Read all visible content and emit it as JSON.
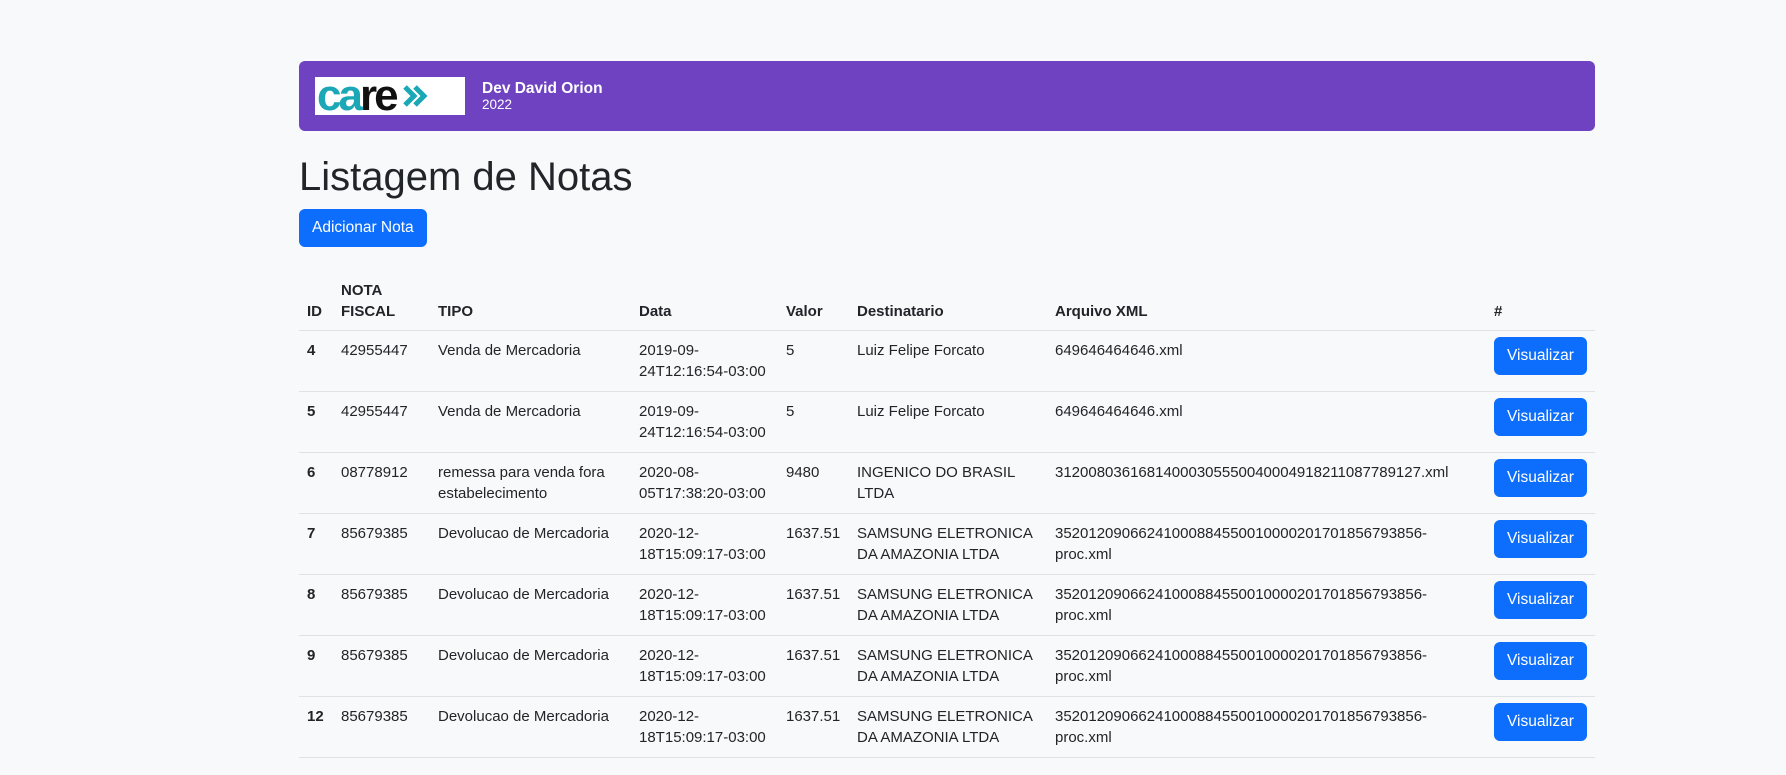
{
  "header": {
    "logo": {
      "part1": "ca",
      "part2": "re",
      "icon": "double-chevron-right-icon",
      "color_primary": "#1ba7b5",
      "color_secondary": "#111111"
    },
    "brand_name": "Dev David Orion",
    "brand_year": "2022",
    "background_color": "#6f42c1"
  },
  "page": {
    "title": "Listagem de Notas",
    "add_button_label": "Adicionar Nota",
    "accent_color": "#0d6efd"
  },
  "table": {
    "headers": {
      "id": "ID",
      "nota_fiscal": "NOTA FISCAL",
      "tipo": "TIPO",
      "data": "Data",
      "valor": "Valor",
      "destinatario": "Destinatario",
      "arquivo": "Arquivo XML",
      "action": "#"
    },
    "rows": [
      {
        "id": "4",
        "nota_fiscal": "42955447",
        "tipo": "Venda de Mercadoria",
        "data": "2019-09-24T12:16:54-03:00",
        "valor": "5",
        "destinatario": "Luiz Felipe Forcato",
        "arquivo": "649646464646.xml",
        "action_label": "Visualizar"
      },
      {
        "id": "5",
        "nota_fiscal": "42955447",
        "tipo": "Venda de Mercadoria",
        "data": "2019-09-24T12:16:54-03:00",
        "valor": "5",
        "destinatario": "Luiz Felipe Forcato",
        "arquivo": "649646464646.xml",
        "action_label": "Visualizar"
      },
      {
        "id": "6",
        "nota_fiscal": "08778912",
        "tipo": "remessa para venda fora estabelecimento",
        "data": "2020-08-05T17:38:20-03:00",
        "valor": "9480",
        "destinatario": "INGENICO DO BRASIL LTDA",
        "arquivo": "31200803616814000305550040004918211087789127.xml",
        "action_label": "Visualizar"
      },
      {
        "id": "7",
        "nota_fiscal": "85679385",
        "tipo": "Devolucao de Mercadoria",
        "data": "2020-12-18T15:09:17-03:00",
        "valor": "1637.51",
        "destinatario": "SAMSUNG ELETRONICA DA AMAZONIA LTDA",
        "arquivo": "35201209066241000884550010000201701856793856-proc.xml",
        "action_label": "Visualizar"
      },
      {
        "id": "8",
        "nota_fiscal": "85679385",
        "tipo": "Devolucao de Mercadoria",
        "data": "2020-12-18T15:09:17-03:00",
        "valor": "1637.51",
        "destinatario": "SAMSUNG ELETRONICA DA AMAZONIA LTDA",
        "arquivo": "35201209066241000884550010000201701856793856-proc.xml",
        "action_label": "Visualizar"
      },
      {
        "id": "9",
        "nota_fiscal": "85679385",
        "tipo": "Devolucao de Mercadoria",
        "data": "2020-12-18T15:09:17-03:00",
        "valor": "1637.51",
        "destinatario": "SAMSUNG ELETRONICA DA AMAZONIA LTDA",
        "arquivo": "35201209066241000884550010000201701856793856-proc.xml",
        "action_label": "Visualizar"
      },
      {
        "id": "12",
        "nota_fiscal": "85679385",
        "tipo": "Devolucao de Mercadoria",
        "data": "2020-12-18T15:09:17-03:00",
        "valor": "1637.51",
        "destinatario": "SAMSUNG ELETRONICA DA AMAZONIA LTDA",
        "arquivo": "35201209066241000884550010000201701856793856-proc.xml",
        "action_label": "Visualizar"
      }
    ]
  }
}
